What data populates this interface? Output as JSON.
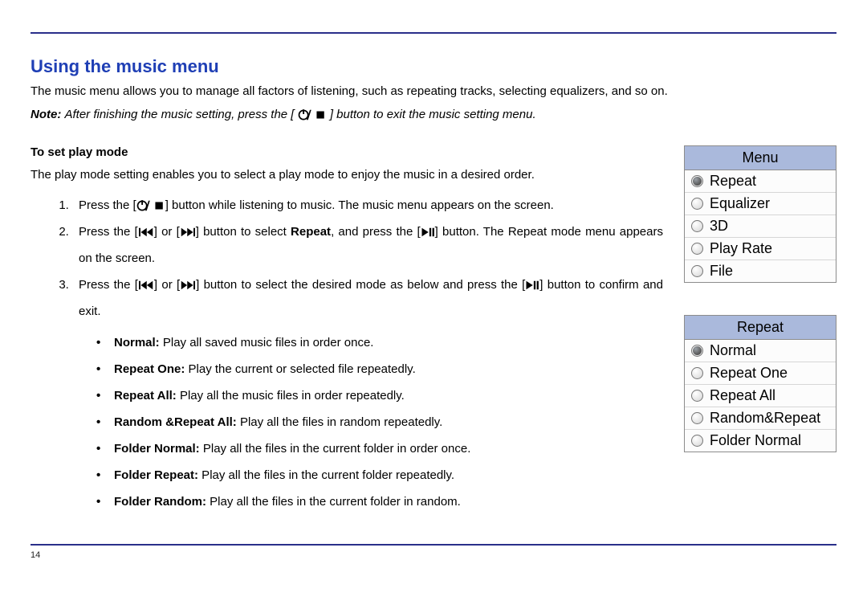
{
  "page_number": "14",
  "section_title": "Using the music menu",
  "intro": "The music menu allows you to manage all factors of listening, such as repeating tracks, selecting equalizers, and so on.",
  "note_label": "Note:",
  "note_before": " After finishing the music setting, press the [",
  "note_after": "] button to exit the music setting menu.",
  "sub_title": "To set play mode",
  "play_mode_intro": "The play mode setting enables you to select a play mode to enjoy the music in a desired order.",
  "steps": {
    "1": {
      "a": "Press the [",
      "b": "] button while listening to music. The music menu appears on the screen."
    },
    "2": {
      "a": "Press the [",
      "b": "] or [",
      "c": "] button to select ",
      "repeat": "Repeat",
      "d": ", and press the [",
      "e": "] button. The Repeat mode menu appears on the screen."
    },
    "3": {
      "a": "Press the [",
      "b": "] or [",
      "c": "] button to select the desired mode as below and press the [",
      "d": "] button to confirm and exit."
    }
  },
  "modes": [
    {
      "name": "Normal:",
      "desc": " Play all saved music files in order once."
    },
    {
      "name": "Repeat One:",
      "desc": " Play the current or selected file repeatedly."
    },
    {
      "name": "Repeat All:",
      "desc": " Play all the music files in order repeatedly."
    },
    {
      "name": "Random &Repeat All:",
      "desc": " Play all the files in random repeatedly."
    },
    {
      "name": "Folder Normal:",
      "desc": " Play all the files in the current folder in order once."
    },
    {
      "name": "Folder Repeat:",
      "desc": " Play all the files in the current folder repeatedly."
    },
    {
      "name": "Folder Random:",
      "desc": " Play all the files in the current folder in random."
    }
  ],
  "menu1": {
    "title": "Menu",
    "items": [
      "Repeat",
      "Equalizer",
      "3D",
      "Play Rate",
      "File"
    ],
    "selected": 0
  },
  "menu2": {
    "title": "Repeat",
    "items": [
      "Normal",
      "Repeat One",
      "Repeat All",
      "Random&Repeat",
      "Folder Normal"
    ],
    "selected": 0
  }
}
